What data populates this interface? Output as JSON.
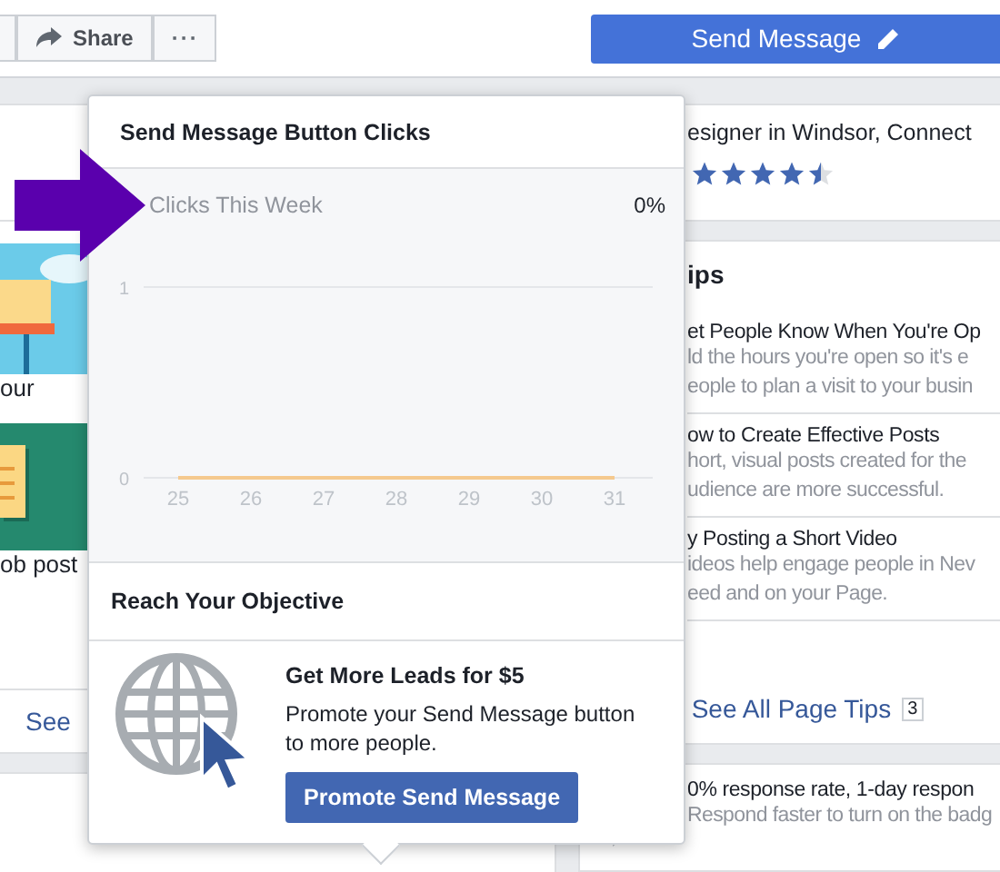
{
  "topbar": {
    "share_label": "Share",
    "more_label": "···",
    "send_message_label": "Send Message"
  },
  "left_column": {
    "items": [
      {
        "caption": "our",
        "kind": "sky"
      },
      {
        "caption": "ob post",
        "kind": "note"
      }
    ],
    "link": "See"
  },
  "popover": {
    "title": "Send Message Button Clicks",
    "stat": "0%",
    "chart_data": {
      "type": "line",
      "title": "Clicks This Week",
      "categories": [
        "25",
        "26",
        "27",
        "28",
        "29",
        "30",
        "31"
      ],
      "yticks": [
        0,
        1
      ],
      "ylim": [
        0,
        1
      ],
      "series": [
        {
          "color": "#f5c98e",
          "values": [
            0,
            0,
            0,
            0,
            0,
            0,
            0
          ]
        }
      ]
    },
    "section_title": "Reach Your Objective",
    "promo": {
      "title": "Get More Leads for $5",
      "text": "Promote your Send Message button to more people.",
      "button": "Promote Send Message"
    }
  },
  "profile": {
    "text": "esigner in Windsor, Connect",
    "stars": 4.5
  },
  "tips": {
    "title": "ips",
    "items": [
      {
        "title": "et People Know When You're Op",
        "lines": [
          "ld the hours you're open so it's e",
          "eople to plan a visit to your busin"
        ]
      },
      {
        "title": "ow to Create Effective Posts",
        "lines": [
          "hort, visual posts created for the",
          "udience are more successful."
        ]
      },
      {
        "title": "y Posting a Short Video",
        "lines": [
          "ideos help engage people in Nev",
          "eed and on your Page."
        ]
      }
    ],
    "link": "See All Page Tips",
    "count": "3"
  },
  "response": {
    "title": "0% response rate, 1-day respon",
    "text": "Respond faster to turn on the badg"
  }
}
